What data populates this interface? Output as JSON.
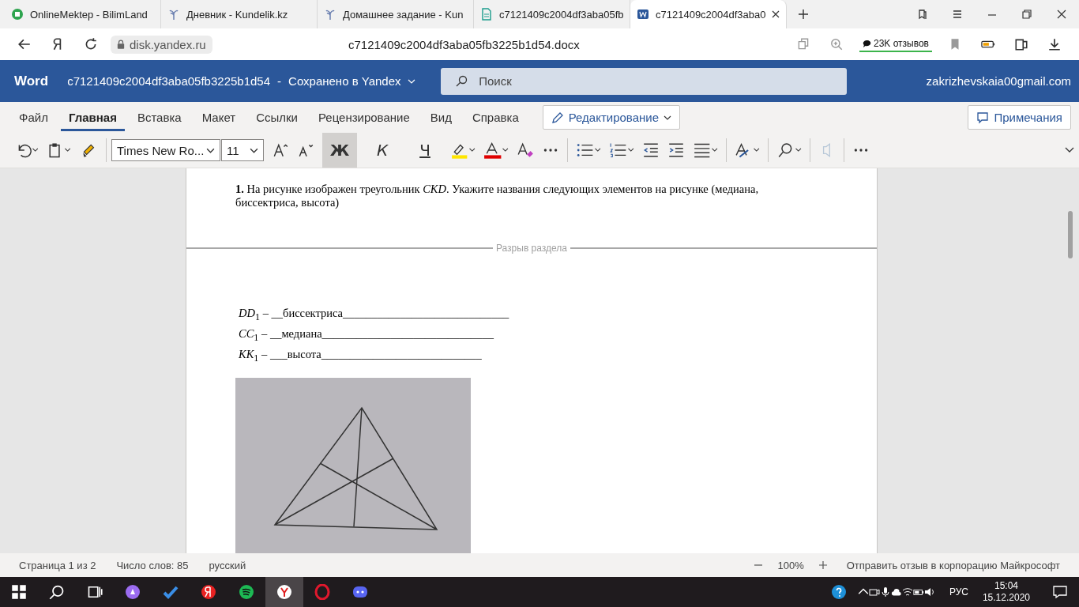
{
  "browser_tabs": [
    {
      "title": "OnlineMektep - BilimLand",
      "kind": "circle",
      "selected": false
    },
    {
      "title": "Дневник - Kundelik.kz",
      "kind": "sprout",
      "selected": false
    },
    {
      "title": "Домашнее задание - Kun",
      "kind": "sprout",
      "selected": false
    },
    {
      "title": "c7121409c2004df3aba05fb",
      "kind": "doc",
      "selected": false
    },
    {
      "title": "c7121409c2004df3aba0",
      "kind": "word",
      "selected": true
    }
  ],
  "address_bar": {
    "domain": "disk.yandex.ru",
    "page_title": "c7121409c2004df3aba05fb3225b1d54.docx",
    "reviews": "23K отзывов"
  },
  "word_header": {
    "app": "Word",
    "document": "c7121409c2004df3aba05fb3225b1d54",
    "separator": "-",
    "save_status": "Сохранено в Yandex",
    "search_placeholder": "Поиск",
    "account": "zakrizhevskaia00gmail.com"
  },
  "ribbon_tabs": [
    {
      "label": "Файл",
      "selected": false
    },
    {
      "label": "Главная",
      "selected": true
    },
    {
      "label": "Вставка",
      "selected": false
    },
    {
      "label": "Макет",
      "selected": false
    },
    {
      "label": "Ссылки",
      "selected": false
    },
    {
      "label": "Рецензирование",
      "selected": false
    },
    {
      "label": "Вид",
      "selected": false
    },
    {
      "label": "Справка",
      "selected": false
    }
  ],
  "mode_button": "Редактирование",
  "comments_button": "Примечания",
  "toolbar": {
    "font": "Times New Ro...",
    "size": "11",
    "format_buttons": [
      {
        "label": "Ж",
        "kind": "bold",
        "selected": true
      },
      {
        "label": "К",
        "kind": "italic",
        "selected": false
      },
      {
        "label": "Ч",
        "kind": "underline",
        "selected": false
      }
    ]
  },
  "document": {
    "question": "**1.** На рисунке изображен треугольник *CKD*. Укажите названия следующих элементов на рисунке (медиана, биссектриса, высота)",
    "section_break": "Разрыв раздела",
    "answers": [
      "*DD*$_{1}$ – __биссектриса_____________________________",
      "*CC*$_{1}$ – __медиана______________________________",
      "*KK*$_{1}$ – ___высота____________________________"
    ]
  },
  "status_bar": {
    "page": "Страница 1 из 2",
    "words": "Число слов: 85",
    "language": "русский",
    "zoom": "100%",
    "feedback": "Отправить отзыв в корпорацию Майкрософт"
  },
  "taskbar": {
    "language": "РУС",
    "time": "15:04",
    "date": "15.12.2020"
  }
}
